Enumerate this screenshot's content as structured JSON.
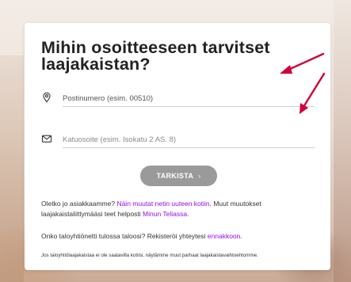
{
  "colors": {
    "link": "#990ae3",
    "annotation_arrow": "#d0003a",
    "button_bg": "#9a9a9a"
  },
  "heading": "Mihin osoitteeseen tarvitset laajakaistan?",
  "postal_field": {
    "icon": "location-pin-icon",
    "placeholder": "Postinumero (esim. 00510)",
    "value": ""
  },
  "street_field": {
    "icon": "envelope-icon",
    "placeholder": "Katuosoite (esim. Isokatu 2 AS. 8)",
    "value": ""
  },
  "check_button": {
    "label": "TARKISTA",
    "chevron": "›"
  },
  "customer_text": {
    "before": "Oletko jo asiakkaamme? ",
    "link1": "Näin muutat netin uuteen kotiin",
    "middle": ". Muut muutokset laajakaistaliittymääsi teet helposti ",
    "link2": "Minun Teliassa",
    "after": "."
  },
  "housing_text": {
    "before": "Onko taloyhtiönetti tulossa taloosi? Rekisteröi yhteytesi ",
    "link": "ennakkoon",
    "after": "."
  },
  "footnote": "Jos taloyhtiölaajakaistaa ei ole saatavilla kotiisi, näytämme muut parhaat laajakaistavaihtoehtomme."
}
